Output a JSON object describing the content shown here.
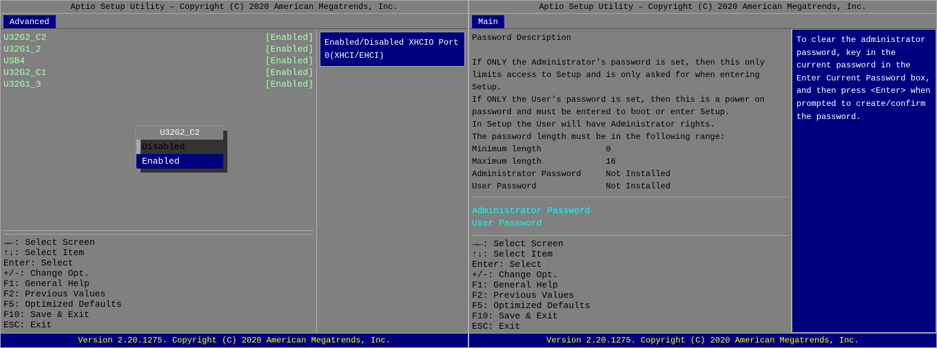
{
  "left_screen": {
    "header": "Aptio Setup Utility – Copyright (C) 2020 American Megatrends, Inc.",
    "tab": "Advanced",
    "settings": [
      {
        "key": "U32G2_C2",
        "value": "[Enabled]"
      },
      {
        "key": "U32G1_2",
        "value": "[Enabled]"
      },
      {
        "key": "USB4",
        "value": "[Enabled]"
      },
      {
        "key": "U32G2_C1",
        "value": "[Enabled]"
      },
      {
        "key": "U32G1_3",
        "value": "[Enabled]"
      }
    ],
    "dropdown": {
      "title": "U32G2_C2",
      "items": [
        {
          "label": "Disabled",
          "selected": false
        },
        {
          "label": "Enabled",
          "selected": true
        }
      ]
    },
    "right_help": {
      "text": "Enabled/Disabled XHCIO Port 0(XHCI/EHCI)"
    },
    "keys": [
      "→←: Select Screen",
      "↑↓: Select Item",
      "Enter: Select",
      "+/-: Change Opt.",
      "F1: General Help",
      "F2: Previous Values",
      "F5: Optimized Defaults",
      "F10: Save & Exit",
      "ESC: Exit"
    ],
    "footer": "Version 2.20.1275. Copyright (C) 2020 American Megatrends, Inc."
  },
  "right_screen": {
    "header": "Aptio Setup Utility – Copyright (C) 2020 American Megatrends, Inc.",
    "tab": "Main",
    "description": {
      "lines": [
        "Password Description",
        "",
        "If ONLY the Administrator's password is set, then this only",
        "limits access to Setup and is only asked for when entering",
        "Setup.",
        "If ONLY the User's password is set, then this is a power on",
        "password and must be entered to boot or enter Setup.",
        "In Setup the User will have Administrator rights.",
        "The password length must be in the following range:",
        "Minimum length             0",
        "Maximum length             16",
        "Administrator Password     Not Installed",
        "User Password              Not Installed"
      ]
    },
    "password_links": [
      "Administrator Password",
      "User Password"
    ],
    "right_help": {
      "text": "To clear the administrator password, key in the current password in the Enter Current Password box, and then press <Enter> when prompted to create/confirm the password."
    },
    "keys": [
      "→←: Select Screen",
      "↑↓: Select Item",
      "Enter: Select",
      "+/-: Change Opt.",
      "F1: General Help",
      "F2: Previous Values",
      "F5: Optimized Defaults",
      "F10: Save & Exit",
      "ESC: Exit"
    ],
    "footer": "Version 2.20.1275. Copyright (C) 2020 American Megatrends, Inc."
  }
}
